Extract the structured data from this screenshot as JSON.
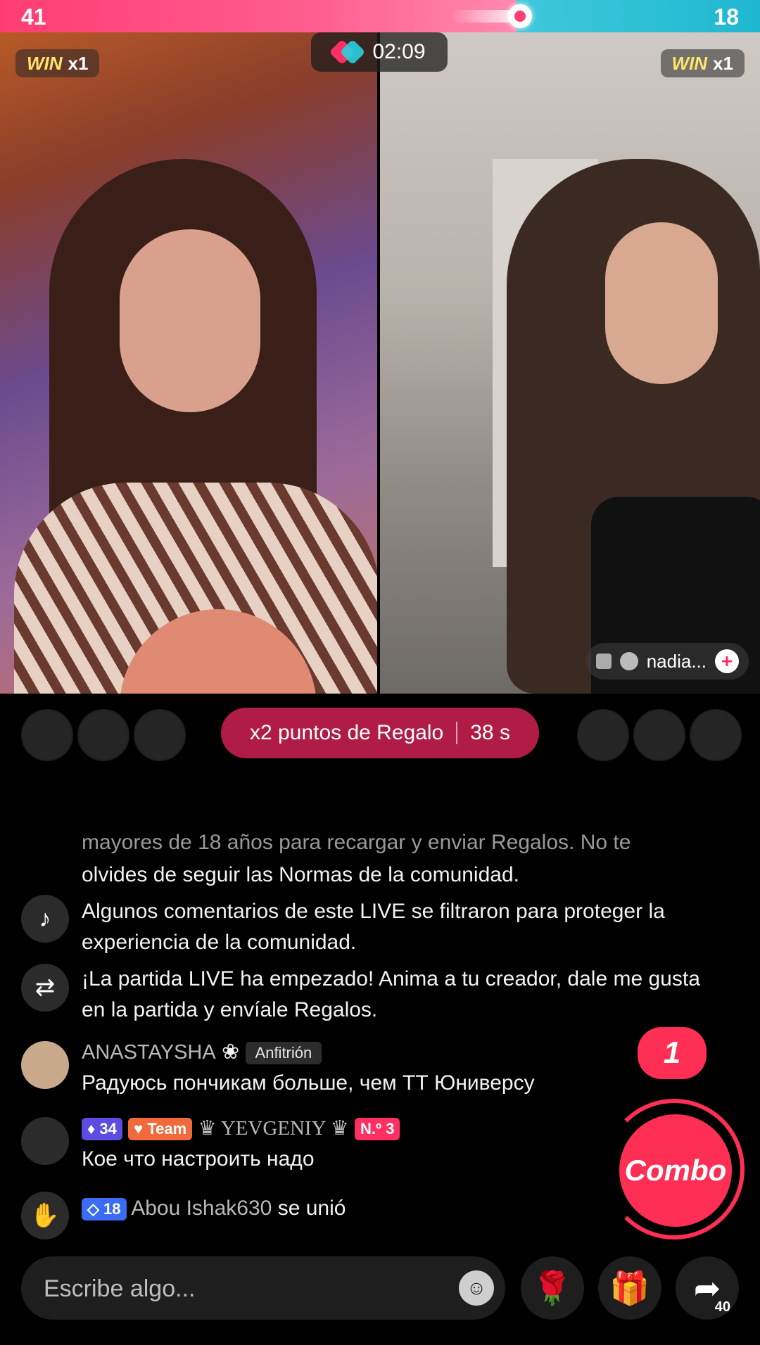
{
  "score": {
    "left": "41",
    "right": "18",
    "left_share": 0.68,
    "left_color": "#ff3d73",
    "right_color": "#1fb7d0"
  },
  "battle": {
    "timer": "02:09",
    "left_win_label": "WIN",
    "left_win_mult": "x1",
    "right_win_label": "WIN",
    "right_win_mult": "x1",
    "right_host_name": "nadia..."
  },
  "boost": {
    "label": "x2 puntos de Regalo",
    "countdown": "38 s",
    "color": "#b01c46"
  },
  "chat": {
    "sys_guidelines_cut": "mayores de 18 años para recargar y enviar Regalos. No te",
    "sys_guidelines": "olvides de seguir las Normas de la comunidad.",
    "sys_filtered": "Algunos comentarios de este LIVE se filtraron para proteger la experiencia de la comunidad.",
    "sys_match": "¡La partida LIVE ha empezado! Anima a tu creador, dale me gusta en la partida y envíale Regalos.",
    "msg1_user": "ANASTAYSHA",
    "msg1_badge": "Anfitrión",
    "msg1_text": "Радуюсь пончикам больше, чем ТТ Юниверсу",
    "msg2_level": "34",
    "msg2_team": "Team",
    "msg2_user": "♛ YEVGENIY ♛",
    "msg2_rank": "N.º 3",
    "msg2_text": "Кое что настроить надо",
    "join_level": "18",
    "join_user": "Abou Ishak630",
    "join_text": "se unió"
  },
  "combo": {
    "count": "1",
    "label": "Combo",
    "color": "#ff2e55"
  },
  "bottom": {
    "placeholder": "Escribe algo...",
    "share_count": "40"
  },
  "icons": [
    "tiktok-icon",
    "match-icon",
    "wave-icon",
    "emoji-icon",
    "rose-icon",
    "gift-icon",
    "share-icon",
    "speaker-mute-icon",
    "plus-icon"
  ]
}
